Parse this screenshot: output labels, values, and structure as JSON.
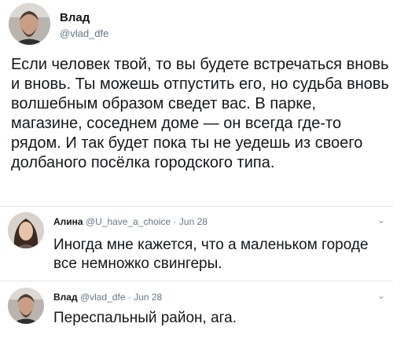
{
  "tweet": {
    "author_name": "Влад",
    "author_handle": "@vlad_dfe",
    "text": "Если человек твой, то вы будете встречаться вновь и вновь. Ты можешь отпустить его, но судьба вновь волшебным образом сведет вас. В парке, магазине, соседнем доме — он всегда где-то рядом. И так будет пока ты не уедешь из своего долбаного посёлка городского типа."
  },
  "replies": [
    {
      "author_name": "Алина",
      "author_handle": "@U_have_a_choice",
      "separator": "·",
      "date": "Jun 28",
      "text": "Иногда мне кажется, что а маленьком городе все немножко свингеры.",
      "menu_icon": "chevron-down-icon"
    },
    {
      "author_name": "Влад",
      "author_handle": "@vlad_dfe",
      "separator": "·",
      "date": "Jun 28",
      "text": "Переспальный район, ага.",
      "menu_icon": "chevron-down-icon"
    }
  ],
  "colors": {
    "text": "#14171a",
    "muted": "#657786",
    "divider": "#e1e8ed"
  }
}
